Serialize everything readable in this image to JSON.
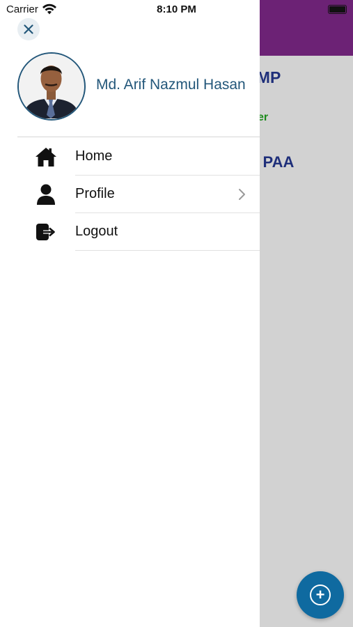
{
  "status_bar": {
    "carrier": "Carrier",
    "time": "8:10 PM"
  },
  "background_screen": {
    "header_color": "#6c2275",
    "name_tail": ", MP",
    "role_tail": "er",
    "org_tail": "n PAA"
  },
  "drawer": {
    "user_name": "Md. Arif Nazmul Hasan",
    "menu": [
      {
        "label": "Home",
        "icon": "home-icon"
      },
      {
        "label": "Profile",
        "icon": "person-icon",
        "has_chevron": true
      },
      {
        "label": "Logout",
        "icon": "logout-icon"
      }
    ]
  },
  "colors": {
    "accent": "#23577a",
    "fab": "#0f6aa0",
    "header_purple": "#6c2275",
    "dim_overlay": "#d2d2d2"
  }
}
